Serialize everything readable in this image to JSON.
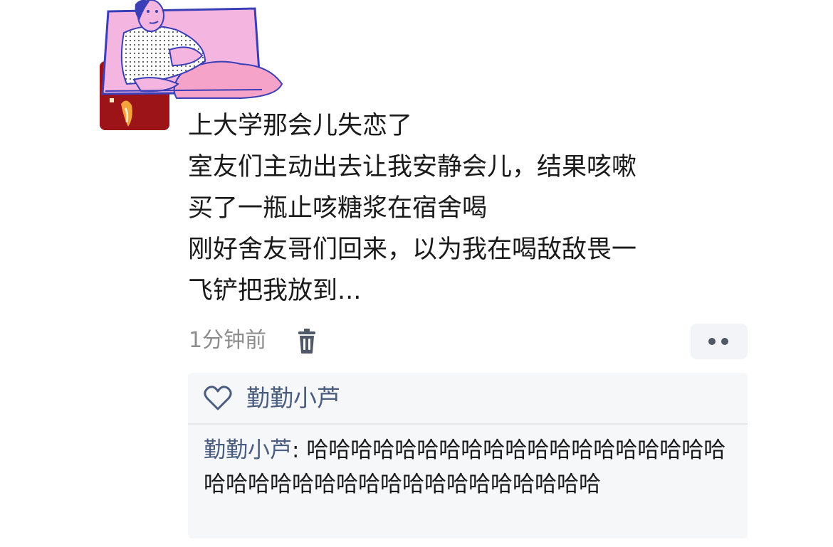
{
  "post": {
    "avatar_icon": "cartoon-avatar-icon",
    "lines": [
      "上大学那会儿失恋了",
      "室友们主动出去让我安静会儿，结果咳嗽",
      "买了一瓶止咳糖浆在宿舍喝",
      "刚好舍友哥们回来，以为我在喝敌敌畏一",
      "飞铲把我放到..."
    ],
    "time": "1分钟前",
    "delete_icon": "trash-icon",
    "more_icon": "more-dots-icon"
  },
  "interactions": {
    "like_icon": "heart-outline-icon",
    "likers": "勤勤小芦",
    "reply_author": "勤勤小芦",
    "reply_separator": ": ",
    "reply_text": "哈哈哈哈哈哈哈哈哈哈哈哈哈哈哈哈哈哈哈哈哈哈哈哈哈哈哈哈哈哈哈哈哈哈哈哈哈"
  },
  "colors": {
    "link_blue": "#4a5d80",
    "avatar_pink": "#f4b6e0",
    "avatar_red": "#9c1418",
    "panel_bg": "#f6f7f9"
  }
}
